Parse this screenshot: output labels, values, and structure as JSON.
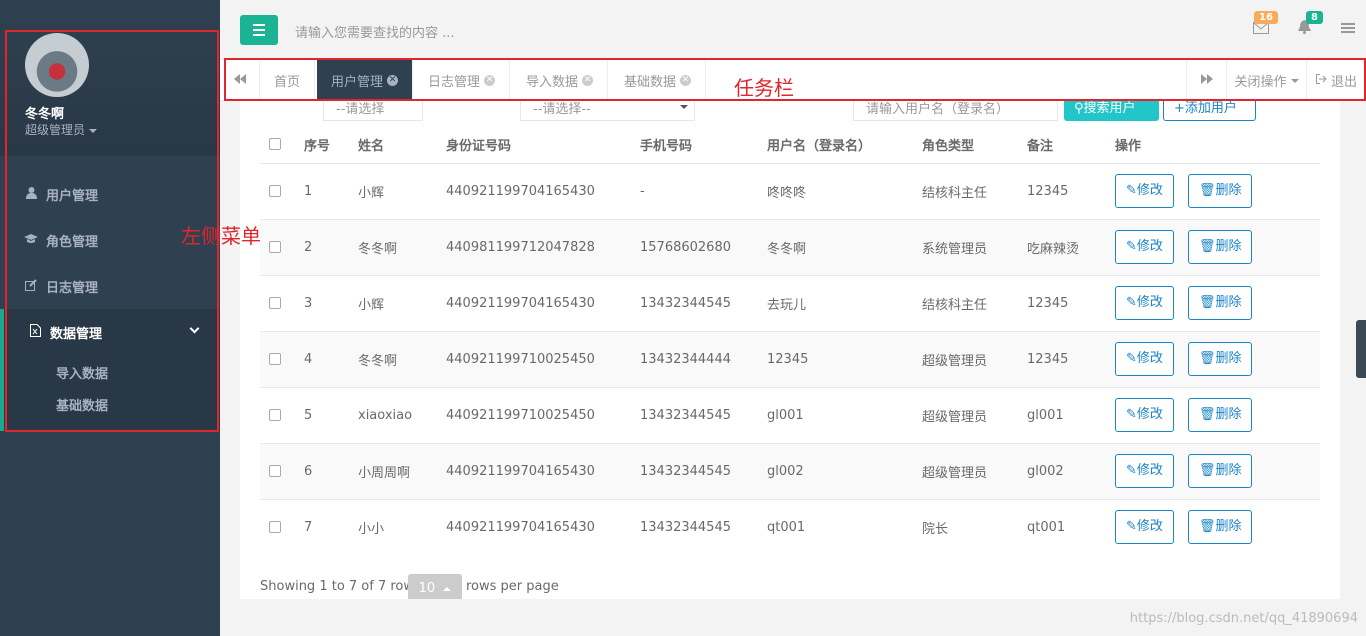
{
  "sidebar": {
    "user_name": "冬冬啊",
    "user_role": "超级管理员",
    "menu": [
      {
        "label": "用户管理",
        "icon": "user-icon"
      },
      {
        "label": "角色管理",
        "icon": "graduation-cap-icon"
      },
      {
        "label": "日志管理",
        "icon": "edit-icon"
      },
      {
        "label": "数据管理",
        "icon": "file-excel-icon"
      }
    ],
    "submenu": [
      "导入数据",
      "基础数据"
    ]
  },
  "annotations": {
    "left_menu": "左侧菜单",
    "taskbar": "任务栏"
  },
  "header": {
    "search_placeholder": "请输入您需要查找的内容 ...",
    "mail_count": "16",
    "bell_count": "8"
  },
  "tabs": {
    "items": [
      "首页",
      "用户管理",
      "日志管理",
      "导入数据",
      "基础数据"
    ],
    "active_index": 1,
    "close_ops": "关闭操作",
    "logout": "退出"
  },
  "filters": {
    "select1": "--请选择",
    "select2": "--请选择--",
    "search_placeholder": "请输入用户名（登录名）",
    "search_button": "搜索用户",
    "add_button": "添加用户"
  },
  "table": {
    "headers": [
      "序号",
      "姓名",
      "身份证号码",
      "手机号码",
      "用户名（登录名）",
      "角色类型",
      "备注",
      "操作"
    ],
    "rows": [
      [
        "1",
        "小辉",
        "440921199704165430",
        "-",
        "咚咚咚",
        "结核科主任",
        "12345"
      ],
      [
        "2",
        "冬冬啊",
        "440981199712047828",
        "15768602680",
        "冬冬啊",
        "系统管理员",
        "吃麻辣烫"
      ],
      [
        "3",
        "小辉",
        "440921199704165430",
        "13432344545",
        "去玩儿",
        "结核科主任",
        "12345"
      ],
      [
        "4",
        "冬冬啊",
        "440921199710025450",
        "13432344444",
        "12345",
        "超级管理员",
        "12345"
      ],
      [
        "5",
        "xiaoxiao",
        "440921199710025450",
        "13432344545",
        "gl001",
        "超级管理员",
        "gl001"
      ],
      [
        "6",
        "小周周啊",
        "440921199704165430",
        "13432344545",
        "gl002",
        "超级管理员",
        "gl002"
      ],
      [
        "7",
        "小小",
        "440921199704165430",
        "13432344545",
        "qt001",
        "院长",
        "qt001"
      ]
    ],
    "edit_label": "修改",
    "delete_label": "删除"
  },
  "pagination": {
    "showing": "Showing 1 to 7 of 7 rows",
    "page_size": "10",
    "per_page": "rows per page"
  },
  "watermark": "https://blog.csdn.net/qq_41890694"
}
